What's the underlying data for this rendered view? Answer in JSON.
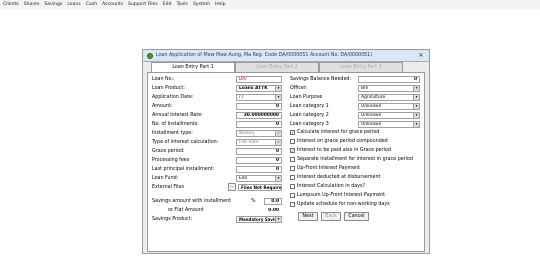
{
  "menu": [
    "Clients",
    "Shares",
    "Savings",
    "Loans",
    "Cash",
    "Accounts",
    "Support Files",
    "Edit",
    "Tools",
    "System",
    "Help"
  ],
  "dialog": {
    "title": "Loan Application of Maw Maw Aung, Ma Reg. Code DA/0000051 Account No. DA/0000051)",
    "close": "✕",
    "tabs": [
      "Loan Entry Part 1",
      "Loan Entry Part 2",
      "Loan Entry Part 3"
    ]
  },
  "left": {
    "loan_no_label": "Loan No.:",
    "loan_no": "DA/",
    "loan_product_label": "Loan Product:",
    "loan_product": "Loans ATTK",
    "application_date_label": "Application Date:",
    "application_date": "/ /",
    "amount_label": "Amount:",
    "amount": "0",
    "interest_rate_label": "Annual Interest Rate:",
    "interest_rate": "30.000000000",
    "installments_label": "No. of Installments:",
    "installments": "0",
    "installment_type_label": "Installment type:",
    "installment_type": "Weekly",
    "interest_calc_label": "Type of interest calculation:",
    "interest_calc": "Flat Rate",
    "grace_label": "Grace period:",
    "grace": "0",
    "processing_label": "Processing fees",
    "processing": "0",
    "last_principal_label": "Last principal installment:",
    "last_principal": "0",
    "loan_fund_label": "Loan Fund:",
    "loan_fund": "Edil",
    "external_label": "External Files",
    "external_btn": "...",
    "external_value": "Files Not Required",
    "savings_with_label": "Savings amount with installment",
    "percent_sign": "%",
    "savings_with": "0.0",
    "flat_label": "or Flat Amount",
    "flat": "0.00",
    "savings_product_label": "Savings Product:",
    "savings_product": "Mandatory Saving"
  },
  "right": {
    "balance_label": "Savings Balance Needed:",
    "balance": "0",
    "officer_label": "Officer:",
    "officer": "Bm",
    "purpose_label": "Loan Purpose",
    "purpose": "Agriculture",
    "cat1_label": "Loan category 1",
    "cat1": "Unknown",
    "cat2_label": "Loan category 2",
    "cat2": "Unknown",
    "cat3_label": "Loan category 3",
    "cat3": "Unknown",
    "checks": [
      {
        "label": "Calculate interest for grace period",
        "checked": true
      },
      {
        "label": "Interest on grace period compounded",
        "checked": false
      },
      {
        "label": "Interest to be paid also in Grace period",
        "checked": true
      },
      {
        "label": "Separate installment for interest in grace period",
        "checked": false
      },
      {
        "label": "Up-Front Interest Payment",
        "checked": false
      },
      {
        "label": "Interest deducted at disbursement",
        "checked": false
      },
      {
        "label": "Interest Calculation in days?",
        "checked": false
      },
      {
        "label": "Lumpsum Up-Front Interest Payment",
        "checked": false
      },
      {
        "label": "Update schedule for non-working days",
        "checked": false
      }
    ],
    "next": "Next",
    "back": "Back",
    "cancel": "Cancel"
  },
  "colors": {
    "title_bg": "#d9e7f6",
    "dialog_bg": "#ececec",
    "red_text": "#cc0000"
  },
  "icons": {
    "dropdown": "▾",
    "check": "✓",
    "app": "app-icon"
  }
}
